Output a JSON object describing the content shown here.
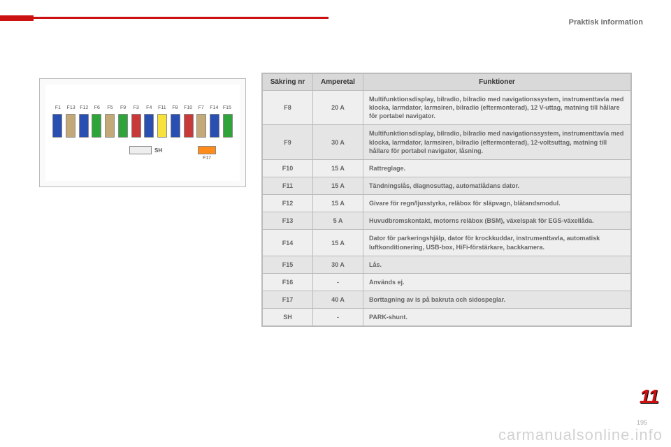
{
  "header": {
    "title": "Praktisk information"
  },
  "chapter": "11",
  "page_no": "195",
  "watermark": "carmanualsonline.info",
  "illustration": {
    "fuse_labels": [
      "F1",
      "F13",
      "F12",
      "F6",
      "F5",
      "F9",
      "F3",
      "F4",
      "F11",
      "F8",
      "F10",
      "F7",
      "F14",
      "F15"
    ],
    "fuse_colors": [
      "#2a4fb3",
      "#c3a878",
      "#2a4fb3",
      "#2fa43a",
      "#c3a878",
      "#2fa43a",
      "#c83a3a",
      "#2a4fb3",
      "#f6e23a",
      "#2a4fb3",
      "#c83a3a",
      "#c3a878",
      "#2a4fb3",
      "#2fa43a"
    ],
    "sh_label": "SH",
    "f17_label": "F17"
  },
  "table": {
    "headers": {
      "fuse": "Säkring nr",
      "amps": "Amperetal",
      "functions": "Funktioner"
    },
    "rows": [
      {
        "fuse": "F8",
        "amps": "20 A",
        "func": "Multifunktionsdisplay, bilradio, bilradio med navigationssystem, instrumenttavla med klocka, larmdator, larmsiren, bilradio (eftermonterad), 12 V-uttag, matning till hållare för portabel navigator."
      },
      {
        "fuse": "F9",
        "amps": "30 A",
        "func": "Multifunktionsdisplay, bilradio, bilradio med navigationssystem, instrumenttavla med klocka, larmdator, larmsiren, bilradio (eftermonterad), 12-voltsuttag, matning till hållare för portabel navigator, låsning."
      },
      {
        "fuse": "F10",
        "amps": "15 A",
        "func": "Rattreglage."
      },
      {
        "fuse": "F11",
        "amps": "15 A",
        "func": "Tändningslås, diagnosuttag, automatlådans dator."
      },
      {
        "fuse": "F12",
        "amps": "15 A",
        "func": "Givare för regn/ljusstyrka, reläbox för släpvagn, blåtandsmodul."
      },
      {
        "fuse": "F13",
        "amps": "5 A",
        "func": "Huvudbromskontakt, motorns reläbox (BSM), växelspak för EGS-växellåda."
      },
      {
        "fuse": "F14",
        "amps": "15 A",
        "func": "Dator för parkeringshjälp, dator för krockkuddar, instrumenttavla, automatisk luftkonditionering, USB-box, HiFi-förstärkare, backkamera."
      },
      {
        "fuse": "F15",
        "amps": "30 A",
        "func": "Lås."
      },
      {
        "fuse": "F16",
        "amps": "-",
        "func": "Används ej."
      },
      {
        "fuse": "F17",
        "amps": "40 A",
        "func": "Borttagning av is på bakruta och sidospeglar."
      },
      {
        "fuse": "SH",
        "amps": "-",
        "func": "PARK-shunt."
      }
    ]
  }
}
